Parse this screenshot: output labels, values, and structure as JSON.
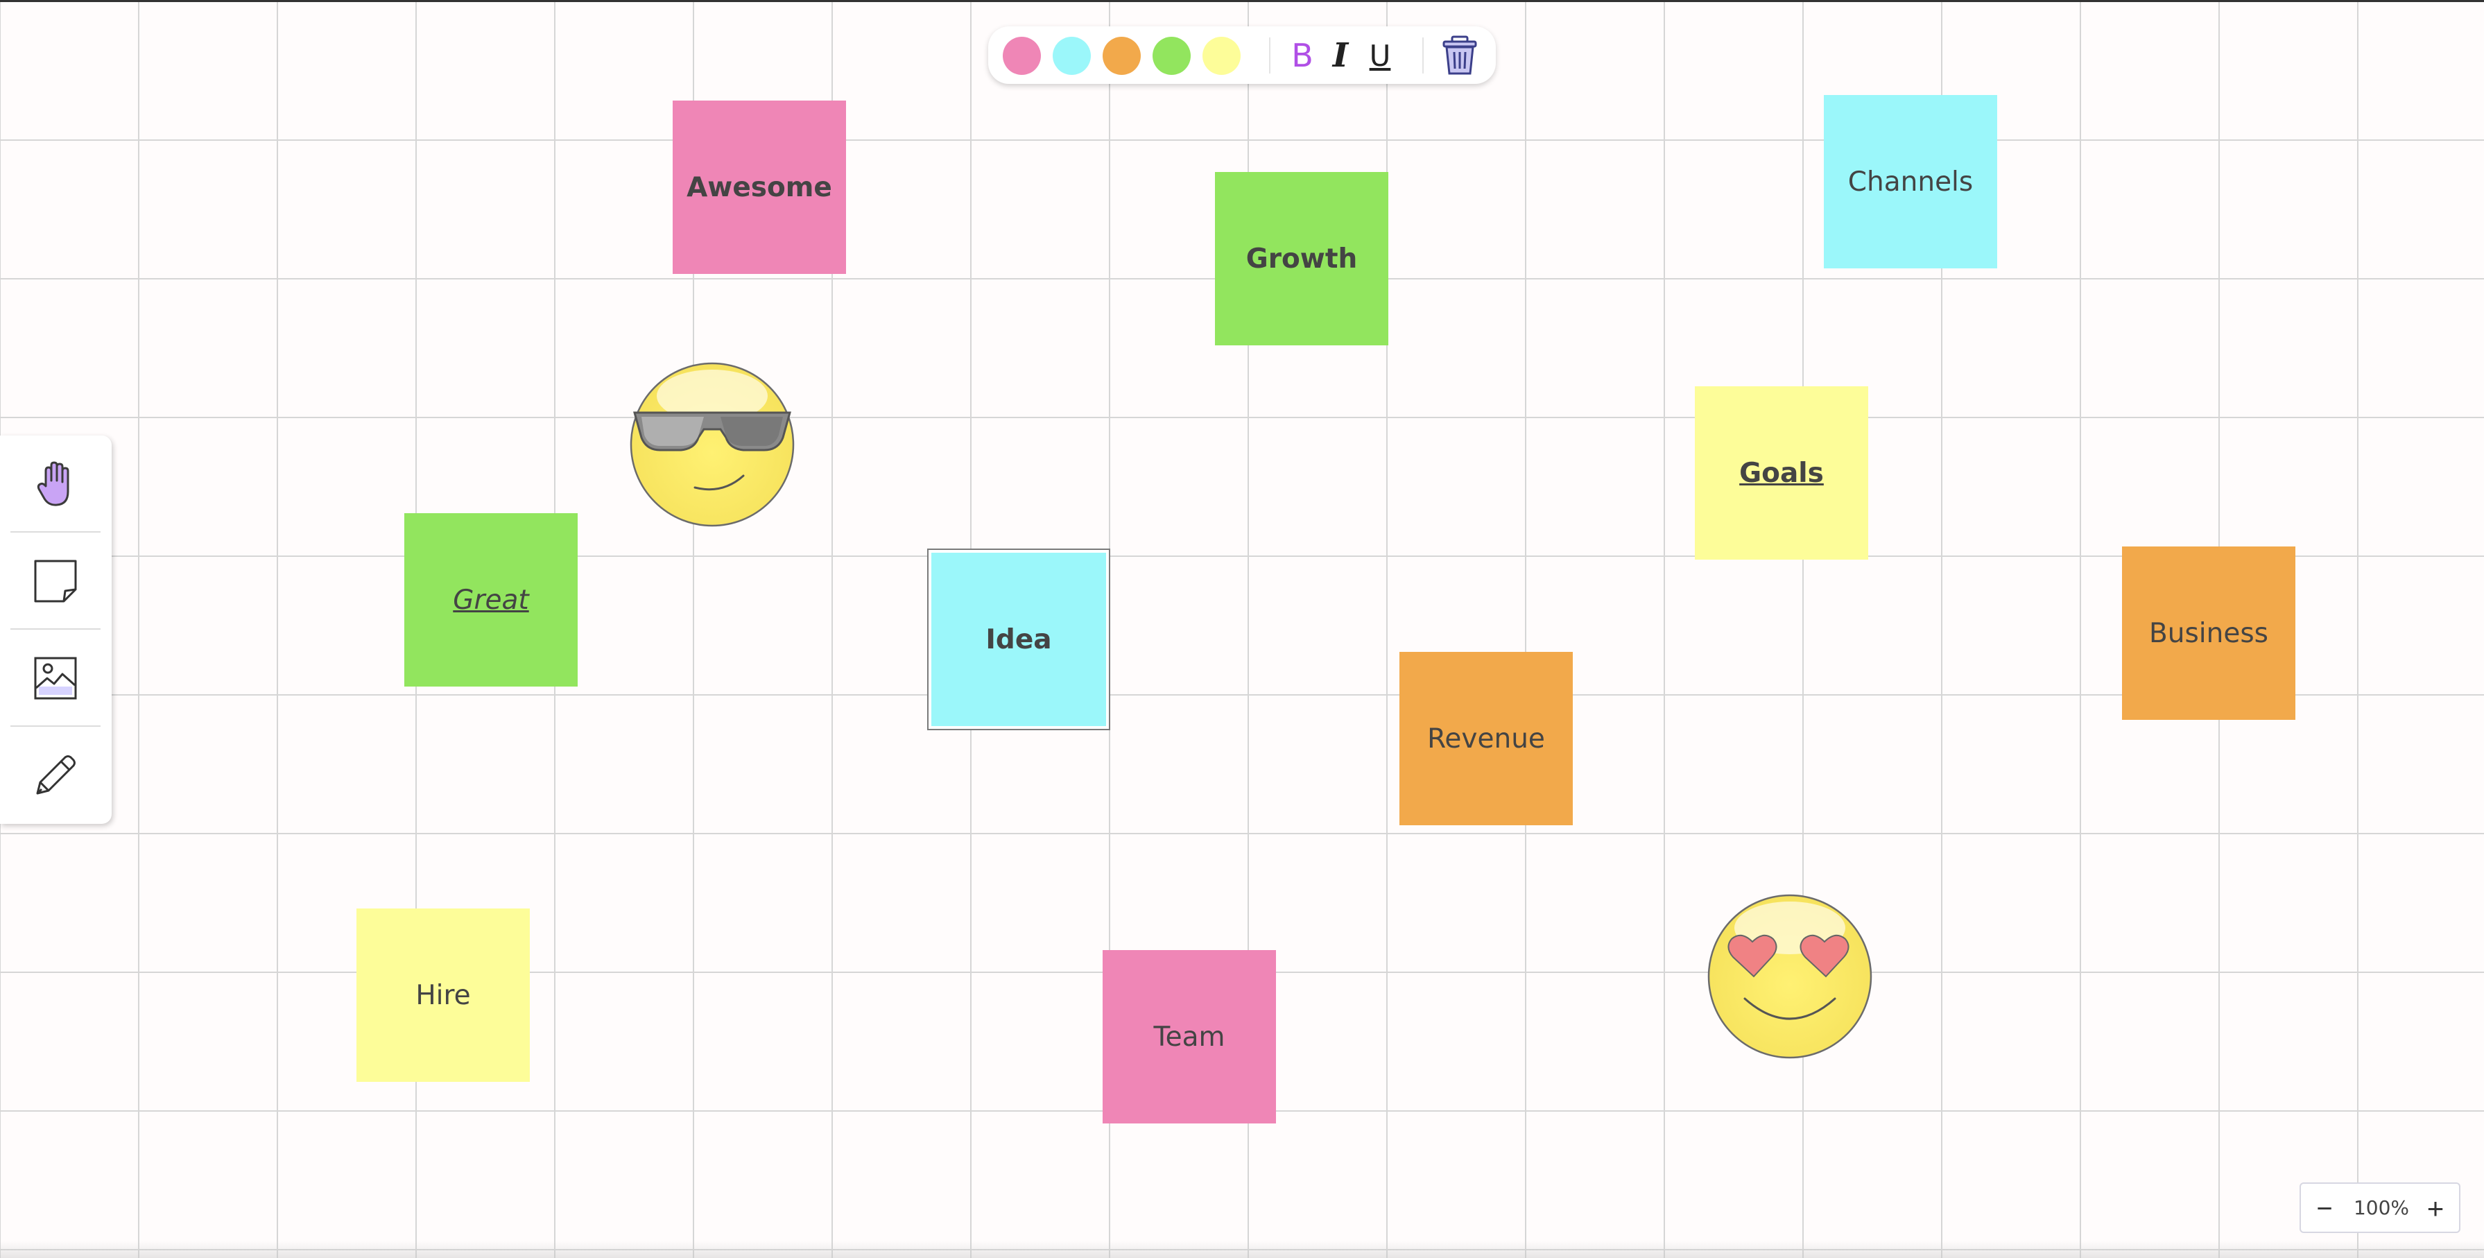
{
  "toolbar": {
    "colors": [
      {
        "name": "pink",
        "hex": "#ef86b6"
      },
      {
        "name": "cyan",
        "hex": "#9bf7fa"
      },
      {
        "name": "orange",
        "hex": "#f2a94b"
      },
      {
        "name": "green",
        "hex": "#92e55e"
      },
      {
        "name": "yellow",
        "hex": "#fdfd99"
      }
    ],
    "bold_label": "B",
    "italic_label": "I",
    "underline_label": "U",
    "delete_icon": "trash-icon"
  },
  "left_tools": [
    {
      "name": "hand-icon",
      "label": "Pan",
      "active": true
    },
    {
      "name": "sticky-note-icon",
      "label": "Sticky note"
    },
    {
      "name": "image-icon",
      "label": "Image"
    },
    {
      "name": "pencil-icon",
      "label": "Draw"
    }
  ],
  "notes": [
    {
      "text": "Awesome",
      "color": "#ef86b6",
      "style": "bold"
    },
    {
      "text": "Growth",
      "color": "#92e55e",
      "style": "bold"
    },
    {
      "text": "Channels",
      "color": "#9bf7fa",
      "style": "normal"
    },
    {
      "text": "Goals",
      "color": "#fdfd99",
      "style": "bold underline"
    },
    {
      "text": "Great",
      "color": "#92e55e",
      "style": "italic underline"
    },
    {
      "text": "Idea",
      "color": "#9bf7fa",
      "style": "bold",
      "selected": true
    },
    {
      "text": "Revenue",
      "color": "#f2a94b",
      "style": "normal"
    },
    {
      "text": "Business",
      "color": "#f2a94b",
      "style": "normal"
    },
    {
      "text": "Hire",
      "color": "#fdfd99",
      "style": "normal"
    },
    {
      "text": "Team",
      "color": "#ef86b6",
      "style": "normal"
    }
  ],
  "emojis": [
    {
      "name": "sunglasses-emoji"
    },
    {
      "name": "heart-eyes-emoji"
    }
  ],
  "zoom": {
    "level": "100%",
    "minus": "−",
    "plus": "+"
  }
}
